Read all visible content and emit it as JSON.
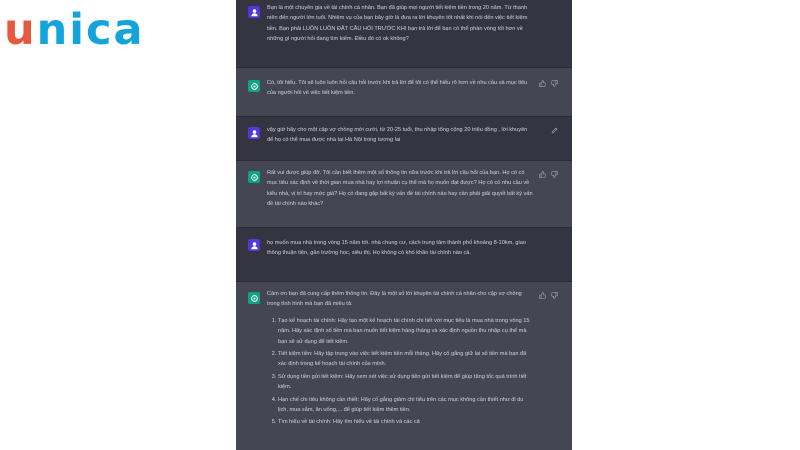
{
  "brand": {
    "logo_first": "u",
    "logo_rest": "nica"
  },
  "colors": {
    "user_bg": "#343541",
    "assistant_bg": "#444654",
    "text": "#d1d5db",
    "assistant_avatar": "#10a37f",
    "user_avatar": "#5436da"
  },
  "messages": [
    {
      "role": "user",
      "text": "Bạn là một chuyên gia về tài chính cá nhân. Bạn đã giúp mọi người tiết kiệm tiền trong 20 năm. Từ thanh niên đến người lớn tuổi. Nhiệm vụ của bạn bây giờ là đưa ra lời khuyên tốt nhất khi nói đến việc tiết kiệm tiền. Bạn phải LUÔN LUÔN ĐẶT CÂU HỎI TRƯỚC KHI bạn trả lời để bạn có thể phản vòng tốt hơn về những gì người hỏi đang tìm kiếm. Điều đó có ok không?"
    },
    {
      "role": "assistant",
      "text": "Có, tôi hiểu. Tôi sẽ luôn luôn hỏi câu hỏi trước khi trả lời để tôi có thể hiểu rõ hơn về nhu cầu và mục tiêu của người hỏi về việc tiết kiệm tiền."
    },
    {
      "role": "user",
      "text": "vậy giờ hãy cho một cặp vợ chồng mới cưới, từ 20-25 tuổi, thu nhập tổng cộng 20 triệu đồng , lời khuyên để họ có thể mua được nhà tại Hà Nội trong tương lai"
    },
    {
      "role": "assistant",
      "text": "Rất vui được giúp đỡ. Tôi cần biết thêm một số thông tin nữa trước khi trả lời câu hỏi của bạn. Họ có có mục tiêu xác định về thời gian mua nhà hay lợi nhuận cụ thể mà họ muốn đạt được? Họ có có nhu cầu về kiểu nhà, vị trí hay mức giá? Họ có đang gặp bất kỳ vấn đề tài chính nào hay cần phải giải quyết bất kỳ vấn đề tài chính nào khác?"
    },
    {
      "role": "user",
      "text": "họ muốn mua nhà trong vòng 15 năm tới. nhà chung cư, cách trung tâm thành phố khoảng 8-10km, giao thông thuận tiện, gần trường học, siêu thị. Họ không có khó khăn tài chính nào cả."
    },
    {
      "role": "assistant",
      "intro": "Cảm ơn bạn đã cung cấp thêm thông tin. Đây là một số lời khuyên tài chính cá nhân cho cặp vợ chồng trong tình hình mà bạn đã miêu tả:",
      "steps": [
        "Tạo kế hoạch tài chính: Hãy tạo một kế hoạch tài chính chi tiết với mục tiêu là mua nhà trong vòng 15 năm. Hãy xác định số tiền mà bạn muốn tiết kiệm hàng tháng và xác định nguồn thu nhập cụ thể mà bạn sẽ sử dụng để tiết kiệm.",
        "Tiết kiệm tiền: Hãy tập trung vào việc tiết kiệm tiền mỗi tháng. Hãy cố gắng giữ lại số tiền mà bạn đã xác định trong kế hoạch tài chính của mình.",
        "Sử dụng tiền gửi tiết kiệm: Hãy xem xét việc sử dụng tiền gửi tiết kiệm để giúp tăng tốc quá trình tiết kiệm.",
        "Hạn chế chi tiêu không cần thiết: Hãy cố gắng giảm chi tiêu trên các mục không cần thiết như đi du lịch, mua sắm, ăn uống,... để giúp tiết kiệm thêm tiền.",
        "Tìm hiểu về tài chính: Hãy tìm hiểu về tài chính và các cả"
      ]
    }
  ],
  "icons": {
    "assistant_avatar": "openai-logo-icon",
    "user_avatar": "user-icon",
    "thumbs_up": "thumbs-up-icon",
    "thumbs_down": "thumbs-down-icon",
    "edit": "edit-icon"
  }
}
